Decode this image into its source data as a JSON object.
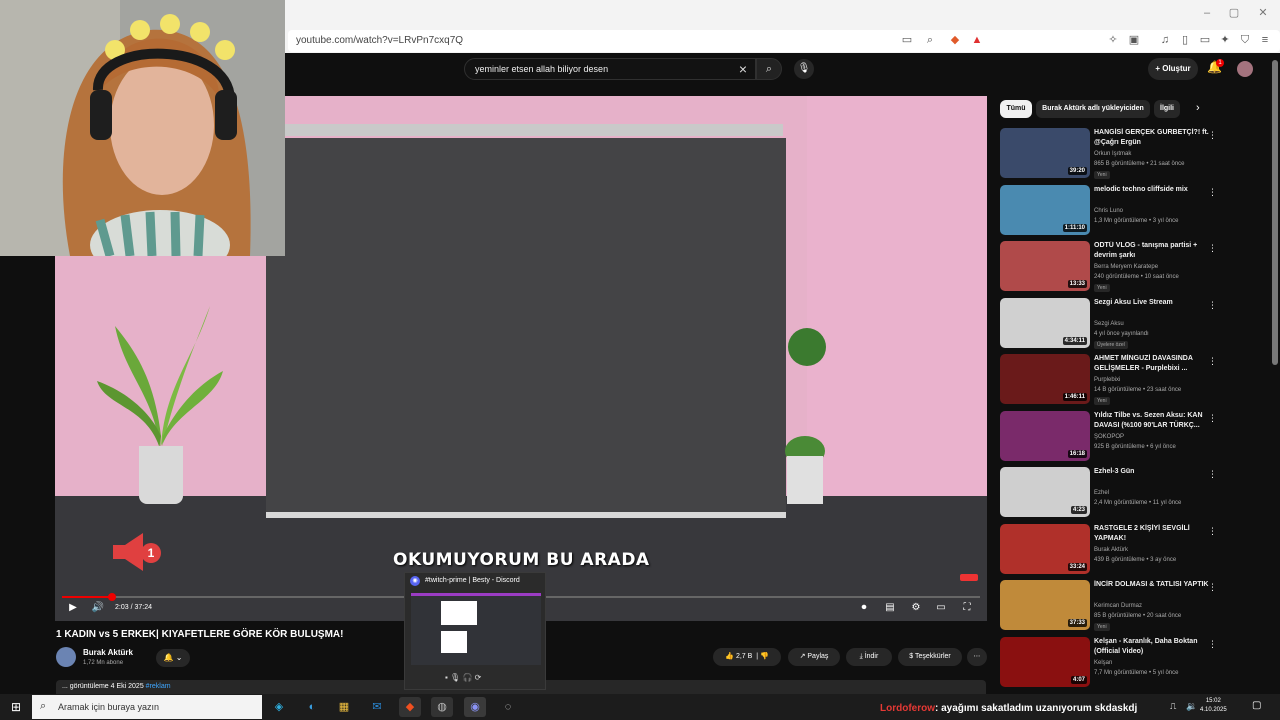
{
  "browser": {
    "url": "youtube.com/watch?v=LRvPn7cxq7Q"
  },
  "youtube": {
    "search_value": "yeminler etsen allah biliyor desen",
    "create_label": "Oluştur",
    "notification_count": "1"
  },
  "player": {
    "caption": "OKUMUYORUM BU ARADA",
    "time": "2:03 / 37:24",
    "progress_fraction": 0.055,
    "speaker_badge": "1"
  },
  "video": {
    "title": "1 KADIN vs 5 ERKEK| KIYAFETLERE GÖRE KÖR BULUŞMA!",
    "channel": "Burak Aktürk",
    "subscribers": "1,72 Mn abone",
    "likes": "2,7 B",
    "share_label": "Paylaş",
    "download_label": "İndir",
    "thanks_label": "Teşekkürler",
    "views_prefix": "... görüntüleme  4 Eki 2025 ",
    "tag": "#reklam"
  },
  "discord_preview": {
    "title": "#twitch-prime | Besty - Discord"
  },
  "sidebar": {
    "chips": [
      "Tümü",
      "Burak Aktürk adlı yükleyiciden",
      "İlgili"
    ],
    "recommendations": [
      {
        "title": "HANGİSİ GERÇEK GURBETÇİ?! ft. @Çağrı Ergün",
        "channel": "Orkun Işıtmak",
        "meta": "865 B görüntüleme • 21 saat önce",
        "badge": "Yeni",
        "duration": "39:20",
        "color": "#3a4a6a"
      },
      {
        "title": "melodic techno cliffside mix",
        "channel": "Chris Luno",
        "meta": "1,3 Mn görüntüleme • 3 yıl önce",
        "badge": "",
        "duration": "1:11:10",
        "color": "#4a8ab0"
      },
      {
        "title": "ODTÜ VLOG - tanışma partisi + devrim şarkı",
        "channel": "Berra Meryem Karatepe",
        "meta": "240 görüntüleme • 10 saat önce",
        "badge": "Yeni",
        "duration": "13:33",
        "color": "#b04a4a"
      },
      {
        "title": "Sezgi Aksu Live Stream",
        "channel": "Sezgi Aksu",
        "meta": "4 yıl önce yayınlandı",
        "badge": "Üyelere özel",
        "duration": "4:34:11",
        "color": "#d0d0d0"
      },
      {
        "title": "AHMET MİNGUZİ DAVASINDA GELİŞMELER - Purplebixi ...",
        "channel": "Purplebixi",
        "meta": "14 B görüntüleme • 23 saat önce",
        "badge": "Yeni",
        "duration": "1:46:11",
        "color": "#6a1a1a"
      },
      {
        "title": "Yıldız Tilbe vs. Sezen Aksu: KAN DAVASI (%100 90'LAR TÜRKÇ...",
        "channel": "ŞOKOPOP",
        "meta": "925 B görüntüleme • 6 yıl önce",
        "badge": "",
        "duration": "16:18",
        "color": "#7a2a6a"
      },
      {
        "title": "Ezhel-3 Gün",
        "channel": "Ezhel",
        "meta": "2,4 Mn görüntüleme • 11 yıl önce",
        "badge": "",
        "duration": "4:23",
        "color": "#cfcfcf"
      },
      {
        "title": "RASTGELE 2 KİŞİYİ SEVGİLİ YAPMAK!",
        "channel": "Burak Aktürk",
        "meta": "439 B görüntüleme • 3 ay önce",
        "badge": "",
        "duration": "33:24",
        "color": "#b0302a"
      },
      {
        "title": "İNCİR DOLMASI & TATLISI YAPTIK",
        "channel": "Kerimcan Durmaz",
        "meta": "85 B görüntüleme • 20 saat önce",
        "badge": "Yeni",
        "duration": "37:33",
        "color": "#c08a3a"
      },
      {
        "title": "Kelşan - Karanlık, Daha Boktan (Official Video)",
        "channel": "Kelşan",
        "meta": "7,7 Mn görüntüleme • 5 yıl önce",
        "badge": "",
        "duration": "4:07",
        "color": "#8a1010"
      }
    ]
  },
  "taskbar": {
    "search_placeholder": "Aramak için buraya yazın",
    "ticker_user": "Lordoferow",
    "ticker_text": ": ayağımı sakatladım uzanıyorum skdaskdj",
    "time": "15:02",
    "date": "4.10.2025"
  },
  "colors": {
    "youtube_red": "#ff0000",
    "link_blue": "#3ea6ff"
  }
}
